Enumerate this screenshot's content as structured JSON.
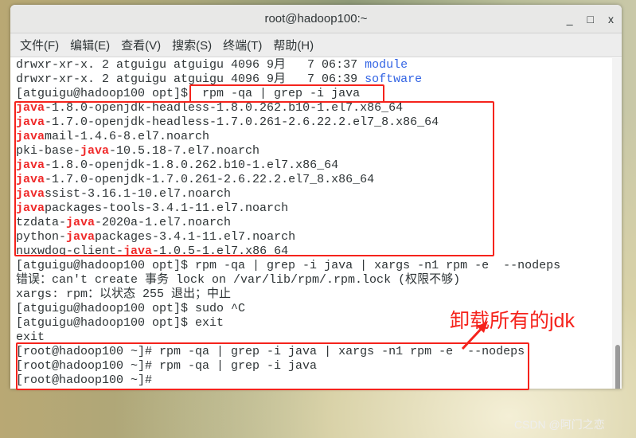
{
  "window": {
    "title": "root@hadoop100:~",
    "minimize": "_",
    "maximize": "□",
    "close": "x"
  },
  "menu": [
    "文件(F)",
    "编辑(E)",
    "查看(V)",
    "搜索(S)",
    "终端(T)",
    "帮助(H)"
  ],
  "ls_lines": [
    {
      "text": "drwxr-xr-x. 2 atguigu atguigu 4096 9月   7 06:37 ",
      "name": "module"
    },
    {
      "text": "drwxr-xr-x. 2 atguigu atguigu 4096 9月   7 06:39 ",
      "name": "software"
    }
  ],
  "cmd1": "[atguigu@hadoop100 opt]$  rpm -qa | grep -i java",
  "packages": [
    [
      "",
      "java",
      "-1.8.0-openjdk-headless-1.8.0.262.b10-1.el7.x86_64"
    ],
    [
      "",
      "java",
      "-1.7.0-openjdk-headless-1.7.0.261-2.6.22.2.el7_8.x86_64"
    ],
    [
      "",
      "java",
      "mail-1.4.6-8.el7.noarch"
    ],
    [
      "pki-base-",
      "java",
      "-10.5.18-7.el7.noarch"
    ],
    [
      "",
      "java",
      "-1.8.0-openjdk-1.8.0.262.b10-1.el7.x86_64"
    ],
    [
      "",
      "java",
      "-1.7.0-openjdk-1.7.0.261-2.6.22.2.el7_8.x86_64"
    ],
    [
      "",
      "java",
      "ssist-3.16.1-10.el7.noarch"
    ],
    [
      "",
      "java",
      "packages-tools-3.4.1-11.el7.noarch"
    ],
    [
      "tzdata-",
      "java",
      "-2020a-1.el7.noarch"
    ],
    [
      "python-",
      "java",
      "packages-3.4.1-11.el7.noarch"
    ],
    [
      "nuxwdog-client-",
      "java",
      "-1.0.5-1.el7.x86_64"
    ]
  ],
  "after_lines": [
    "[atguigu@hadoop100 opt]$ rpm -qa | grep -i java | xargs -n1 rpm -e  --nodeps",
    "错误：can't create 事务 lock on /var/lib/rpm/.rpm.lock (权限不够)",
    "xargs: rpm：以状态 255 退出；中止",
    "[atguigu@hadoop100 opt]$ sudo ^C",
    "[atguigu@hadoop100 opt]$ exit",
    "exit",
    "[root@hadoop100 ~]# rpm -qa | grep -i java | xargs -n1 rpm -e  --nodeps",
    "[root@hadoop100 ~]# rpm -qa | grep -i java",
    "[root@hadoop100 ~]# "
  ],
  "annotation": "卸载所有的jdk",
  "watermark": "CSDN @阿门之恋",
  "colors": {
    "highlight": "#ef2929",
    "annotation": "#f5231c",
    "dir": "#3465e4"
  }
}
